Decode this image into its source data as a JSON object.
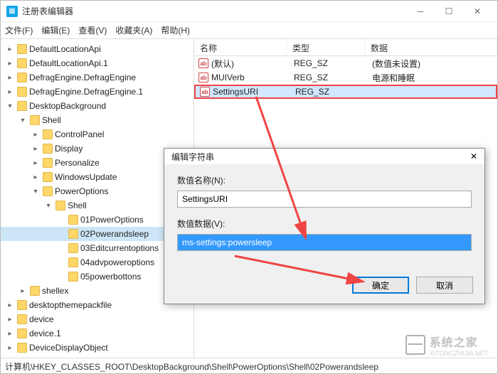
{
  "window": {
    "title": "注册表编辑器"
  },
  "menu": {
    "file": "文件(F)",
    "edit": "编辑(E)",
    "view": "查看(V)",
    "fav": "收藏夹(A)",
    "help": "帮助(H)"
  },
  "tree": [
    {
      "indent": 0,
      "tw": "▸",
      "label": "DefaultLocationApi"
    },
    {
      "indent": 0,
      "tw": "▸",
      "label": "DefaultLocationApi.1"
    },
    {
      "indent": 0,
      "tw": "▸",
      "label": "DefragEngine.DefragEngine"
    },
    {
      "indent": 0,
      "tw": "▸",
      "label": "DefragEngine.DefragEngine.1"
    },
    {
      "indent": 0,
      "tw": "▾",
      "label": "DesktopBackground"
    },
    {
      "indent": 1,
      "tw": "▾",
      "label": "Shell"
    },
    {
      "indent": 2,
      "tw": "▸",
      "label": "ControlPanel"
    },
    {
      "indent": 2,
      "tw": "▸",
      "label": "Display"
    },
    {
      "indent": 2,
      "tw": "▸",
      "label": "Personalize"
    },
    {
      "indent": 2,
      "tw": "▸",
      "label": "WindowsUpdate"
    },
    {
      "indent": 2,
      "tw": "▾",
      "label": "PowerOptions"
    },
    {
      "indent": 3,
      "tw": "▾",
      "label": "Shell"
    },
    {
      "indent": 4,
      "tw": "",
      "label": "01PowerOptions"
    },
    {
      "indent": 4,
      "tw": "",
      "label": "02Powerandsleep",
      "selected": true
    },
    {
      "indent": 4,
      "tw": "",
      "label": "03Editcurrentoptions"
    },
    {
      "indent": 4,
      "tw": "",
      "label": "04advpoweroptions"
    },
    {
      "indent": 4,
      "tw": "",
      "label": "05powerbottons"
    },
    {
      "indent": 1,
      "tw": "▸",
      "label": "shellex"
    },
    {
      "indent": 0,
      "tw": "▸",
      "label": "desktopthemepackfile"
    },
    {
      "indent": 0,
      "tw": "▸",
      "label": "device"
    },
    {
      "indent": 0,
      "tw": "▸",
      "label": "device.1"
    },
    {
      "indent": 0,
      "tw": "▸",
      "label": "DeviceDisplayObject"
    }
  ],
  "list": {
    "headers": {
      "name": "名称",
      "type": "类型",
      "data": "数据"
    },
    "rows": [
      {
        "name": "(默认)",
        "type": "REG_SZ",
        "data": "(数值未设置)"
      },
      {
        "name": "MUIVerb",
        "type": "REG_SZ",
        "data": "电源和睡眠"
      },
      {
        "name": "SettingsURI",
        "type": "REG_SZ",
        "data": "",
        "highlight": true
      }
    ]
  },
  "dialog": {
    "title": "编辑字符串",
    "close": "✕",
    "name_label": "数值名称(N):",
    "name_value": "SettingsURI",
    "data_label": "数值数据(V):",
    "data_value": "ms-settings:powersleep",
    "ok": "确定",
    "cancel": "取消"
  },
  "statusbar": "计算机\\HKEY_CLASSES_ROOT\\DesktopBackground\\Shell\\PowerOptions\\Shell\\02Powerandsleep",
  "watermark": {
    "text": "系统之家",
    "sub": "XITONGZHIJIA.NET"
  }
}
